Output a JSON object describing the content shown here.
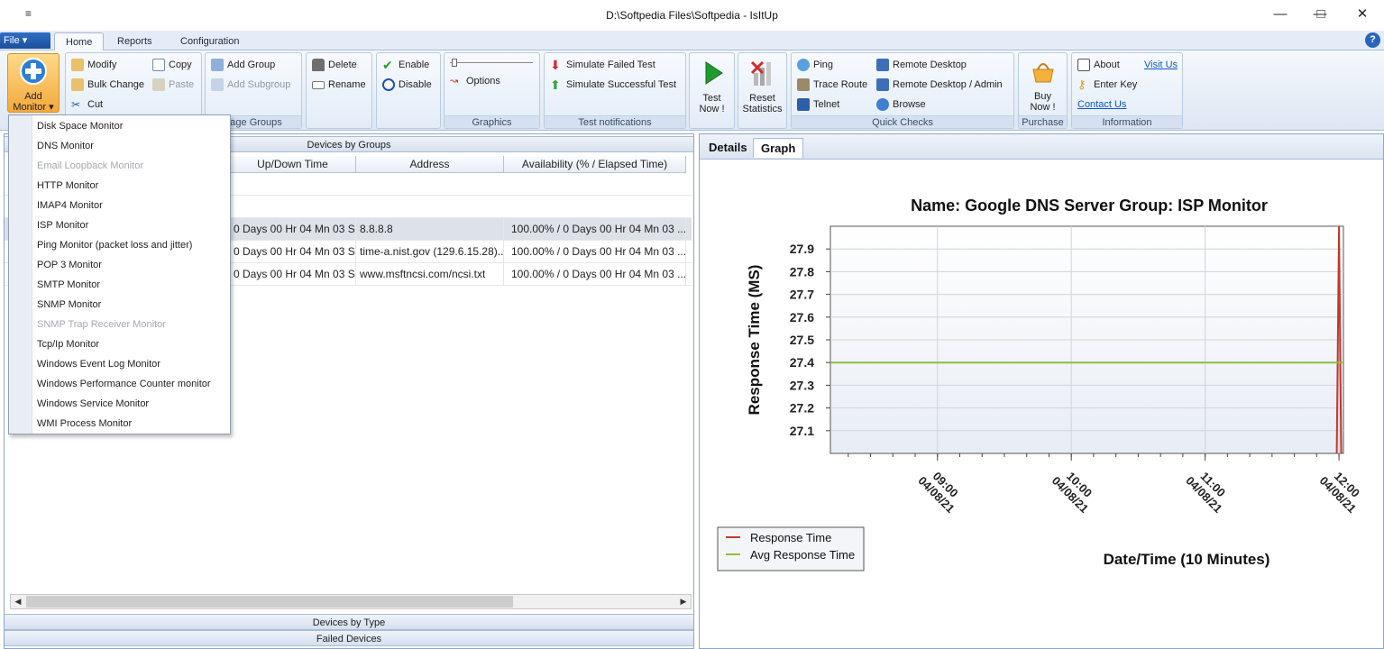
{
  "window": {
    "title": "D:\\Softpedia Files\\Softpedia - IsItUp",
    "quick_access": "≡",
    "minimize": "—",
    "maximize": "□",
    "close": "✕"
  },
  "menu": {
    "file": "File ▾",
    "tabs": [
      "Home",
      "Reports",
      "Configuration"
    ],
    "active_tab": "Home",
    "help": "?"
  },
  "ribbon": {
    "add_monitor": {
      "line1": "Add",
      "line2": "Monitor ▾"
    },
    "edit": {
      "modify": "Modify",
      "copy": "Copy",
      "bulk_change": "Bulk Change",
      "paste": "Paste",
      "cut": "Cut"
    },
    "groups": {
      "add_group": "Add Group",
      "add_subgroup": "Add Subgroup",
      "label": "nage Groups"
    },
    "delete": {
      "delete": "Delete",
      "rename": "Rename"
    },
    "enable": {
      "enable": "Enable",
      "disable": "Disable"
    },
    "graphics": {
      "options": "Options",
      "label": "Graphics"
    },
    "test_notifications": {
      "failed": "Simulate Failed Test",
      "successful": "Simulate Successful Test",
      "label": "Test notifications"
    },
    "test_now": {
      "line1": "Test",
      "line2": "Now !"
    },
    "reset_stats": {
      "line1": "Reset",
      "line2": "Statistics"
    },
    "quick_checks": {
      "ping": "Ping",
      "trace_route": "Trace Route",
      "telnet": "Telnet",
      "remote_desktop": "Remote Desktop",
      "remote_desktop_admin": "Remote Desktop / Admin",
      "browse": "Browse",
      "label": "Quick Checks"
    },
    "purchase": {
      "line1": "Buy",
      "line2": "Now !",
      "label": "Purchase"
    },
    "information": {
      "about": "About",
      "visit_us": "Visit Us",
      "enter_key": "Enter Key",
      "contact_us": "Contact Us",
      "label": "Information"
    }
  },
  "add_monitor_menu": [
    {
      "label": "Disk Space Monitor",
      "enabled": true
    },
    {
      "label": "DNS Monitor",
      "enabled": true
    },
    {
      "label": "Email Loopback Monitor",
      "enabled": false
    },
    {
      "label": "HTTP Monitor",
      "enabled": true
    },
    {
      "label": "IMAP4 Monitor",
      "enabled": true
    },
    {
      "label": "ISP Monitor",
      "enabled": true
    },
    {
      "label": "Ping Monitor (packet loss and jitter)",
      "enabled": true
    },
    {
      "label": "POP 3 Monitor",
      "enabled": true
    },
    {
      "label": "SMTP Monitor",
      "enabled": true
    },
    {
      "label": "SNMP Monitor",
      "enabled": true
    },
    {
      "label": "SNMP Trap Receiver Monitor",
      "enabled": false
    },
    {
      "label": "Tcp/Ip Monitor",
      "enabled": true
    },
    {
      "label": "Windows Event Log Monitor",
      "enabled": true
    },
    {
      "label": "Windows Performance Counter monitor",
      "enabled": true
    },
    {
      "label": "Windows Service Monitor",
      "enabled": true
    },
    {
      "label": "WMI Process Monitor",
      "enabled": true
    }
  ],
  "left_panel": {
    "devices_by_groups": "Devices by Groups",
    "devices_by_type": "Devices by Type",
    "failed_devices": "Failed Devices",
    "columns": [
      "Up/Down Time",
      "Address",
      "Availability (% / Elapsed Time)"
    ],
    "rows": [
      {
        "uptime": "0 Days 00 Hr 04 Mn 03 S...",
        "address": "8.8.8.8",
        "availability": "100.00%  /   0 Days 00 Hr 04 Mn 03 ..."
      },
      {
        "uptime": "0 Days 00 Hr 04 Mn 03 S...",
        "address": "time-a.nist.gov (129.6.15.28)...",
        "availability": "100.00%  /   0 Days 00 Hr 04 Mn 03 ..."
      },
      {
        "uptime": "0 Days 00 Hr 04 Mn 03 S...",
        "address": "www.msftncsi.com/ncsi.txt",
        "availability": "100.00%  /   0 Days 00 Hr 04 Mn 03 ..."
      }
    ],
    "scroll_left": "◀",
    "scroll_right": "▶"
  },
  "right_panel": {
    "tabs": [
      "Details",
      "Graph"
    ],
    "active_tab": "Graph"
  },
  "chart_data": {
    "type": "line",
    "title": "Name: Google DNS Server  Group: ISP Monitor",
    "xlabel": "Date/Time (10 Minutes)",
    "ylabel": "Response Time (MS)",
    "ylim": [
      27.0,
      28.0
    ],
    "yticks": [
      27.1,
      27.2,
      27.3,
      27.4,
      27.5,
      27.6,
      27.7,
      27.8,
      27.9
    ],
    "xticks": [
      {
        "time": "09:00",
        "date": "04/08/21"
      },
      {
        "time": "10:00",
        "date": "04/08/21"
      },
      {
        "time": "11:00",
        "date": "04/08/21"
      },
      {
        "time": "12:00",
        "date": "04/08/21"
      }
    ],
    "xlim": [
      "08:12",
      "12:02"
    ],
    "grid": true,
    "legend_position": "bottom-left",
    "series": [
      {
        "name": "Response Time",
        "color": "#c0392b",
        "points": [
          {
            "x": "11:59",
            "y": 27.0
          },
          {
            "x": "12:00",
            "y": 28.0
          },
          {
            "x": "12:01",
            "y": 27.0
          }
        ]
      },
      {
        "name": "Avg Response Time",
        "color": "#8cbf3f",
        "points": [
          {
            "x": "08:12",
            "y": 27.4
          },
          {
            "x": "12:02",
            "y": 27.4
          }
        ]
      }
    ]
  }
}
